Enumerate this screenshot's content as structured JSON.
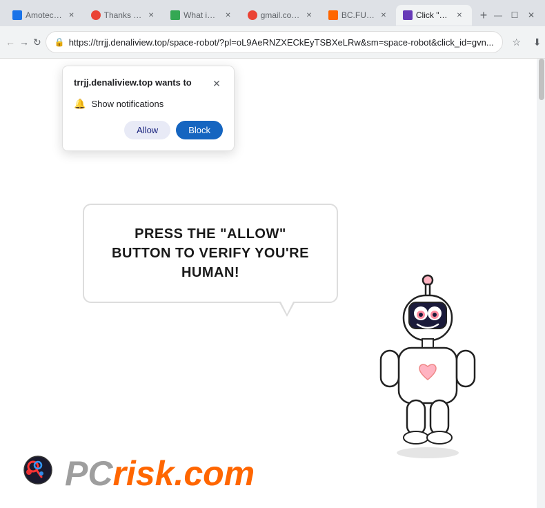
{
  "browser": {
    "tabs": [
      {
        "id": 1,
        "label": "Amotec b...",
        "favicon_color": "#1a73e8",
        "active": false
      },
      {
        "id": 2,
        "label": "Thanks fo...",
        "favicon_color": "#ea4335",
        "active": false
      },
      {
        "id": 3,
        "label": "What is y...",
        "favicon_color": "#34a853",
        "active": false
      },
      {
        "id": 4,
        "label": "gmail.com...",
        "favicon_color": "#ea4335",
        "active": false
      },
      {
        "id": 5,
        "label": "BC.FUN...",
        "favicon_color": "#ff6600",
        "active": false
      },
      {
        "id": 6,
        "label": "Click \"All...",
        "favicon_color": "#673ab7",
        "active": true
      }
    ],
    "url": "https://trrjj.denaliview.top/space-robot/?pl=oL9AeRNZXECkEyTSBXeLRw&sm=space-robot&click_id=gvn...",
    "window_controls": {
      "minimize": "—",
      "maximize": "☐",
      "close": "✕"
    }
  },
  "notification_popup": {
    "title": "trrjj.denaliview.top wants to",
    "close_label": "✕",
    "notification_text": "Show notifications",
    "allow_label": "Allow",
    "block_label": "Block"
  },
  "page": {
    "speech_bubble_text": "PRESS THE \"ALLOW\" BUTTON TO VERIFY YOU'RE HUMAN!",
    "pcrisk_pc": "PC",
    "pcrisk_risk": "risk.com"
  },
  "colors": {
    "allow_btn_bg": "#e8eaf6",
    "allow_btn_text": "#1a237e",
    "block_btn_bg": "#1565c0",
    "block_btn_text": "#ffffff",
    "accent_orange": "#ff6600",
    "text_dark": "#1a1a1a"
  }
}
